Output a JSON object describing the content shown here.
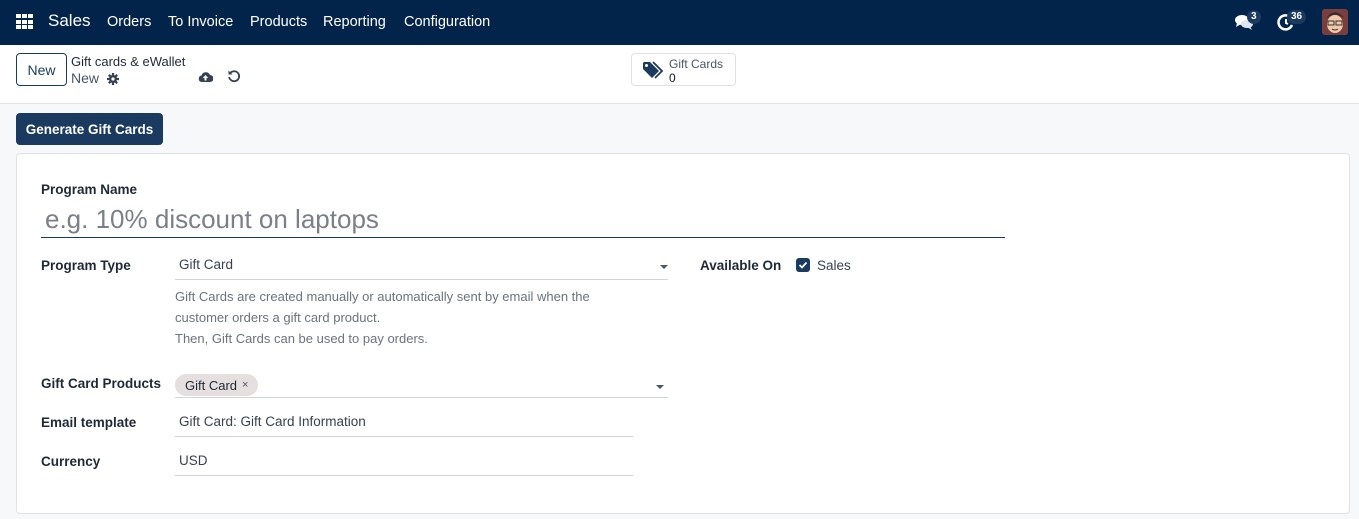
{
  "navbar": {
    "app_name": "Sales",
    "menu": [
      {
        "label": "Orders"
      },
      {
        "label": "To Invoice"
      },
      {
        "label": "Products"
      },
      {
        "label": "Reporting"
      },
      {
        "label": "Configuration"
      }
    ],
    "messages_count": "3",
    "activities_count": "36",
    "bg_color": "#03244a"
  },
  "control_panel": {
    "new_label": "New",
    "breadcrumb_parent": "Gift cards & eWallet",
    "breadcrumb_current": "New",
    "smart_button": {
      "label": "Gift Cards",
      "value": "0"
    }
  },
  "statusbar": {
    "generate_label": "Generate Gift Cards"
  },
  "form": {
    "program_name_label": "Program Name",
    "program_name_placeholder": "e.g. 10% discount on laptops",
    "program_name_value": "",
    "program_type_label": "Program Type",
    "program_type_value": "Gift Card",
    "program_type_help": [
      "Gift Cards are created manually or automatically sent by email when the",
      "customer orders a gift card product.",
      "Then, Gift Cards can be used to pay orders."
    ],
    "available_on_label": "Available On",
    "available_on_option": "Sales",
    "available_on_checked": true,
    "gift_card_products_label": "Gift Card Products",
    "gift_card_products_tags": [
      "Gift Card"
    ],
    "gift_card_tag_remove": "×",
    "email_template_label": "Email template",
    "email_template_value": "Gift Card: Gift Card Information",
    "currency_label": "Currency",
    "currency_value": "USD"
  },
  "accent_color": "#1b3a5f"
}
